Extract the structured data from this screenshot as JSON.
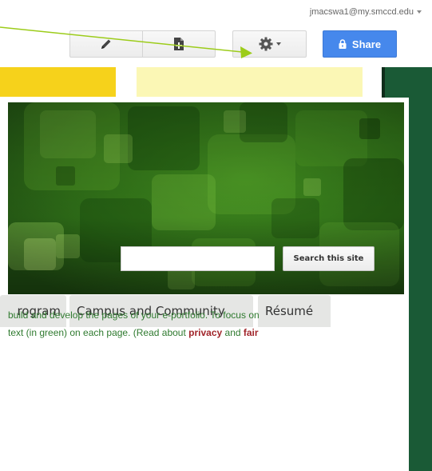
{
  "account": {
    "email": "jmacswa1@my.smccd.edu"
  },
  "toolbar": {
    "edit_icon": "pencil-icon",
    "new_page_icon": "new-page-icon",
    "more_icon": "gear-icon",
    "share_label": "Share",
    "share_icon": "lock-icon",
    "accent_color": "#4688ec"
  },
  "site": {
    "search": {
      "value": "",
      "button_label": "Search this site"
    },
    "nav_tabs": [
      {
        "label": "rogram"
      },
      {
        "label": "Campus and Community"
      },
      {
        "label": "Résumé"
      }
    ],
    "body_line1": "build and develop the pages of your e-portfolio.  To focus on",
    "body_line2_prefix": "text (in green) on each page.   (Read about ",
    "link_privacy": "privacy",
    "and_word": " and ",
    "link_fair": "fair",
    "text_color": "#2f7a2f",
    "link_color": "#a1262b",
    "theme_green": "#1a5a36",
    "theme_yellow": "#f6d21b"
  },
  "annotation": {
    "color": "#9ccc1a"
  }
}
